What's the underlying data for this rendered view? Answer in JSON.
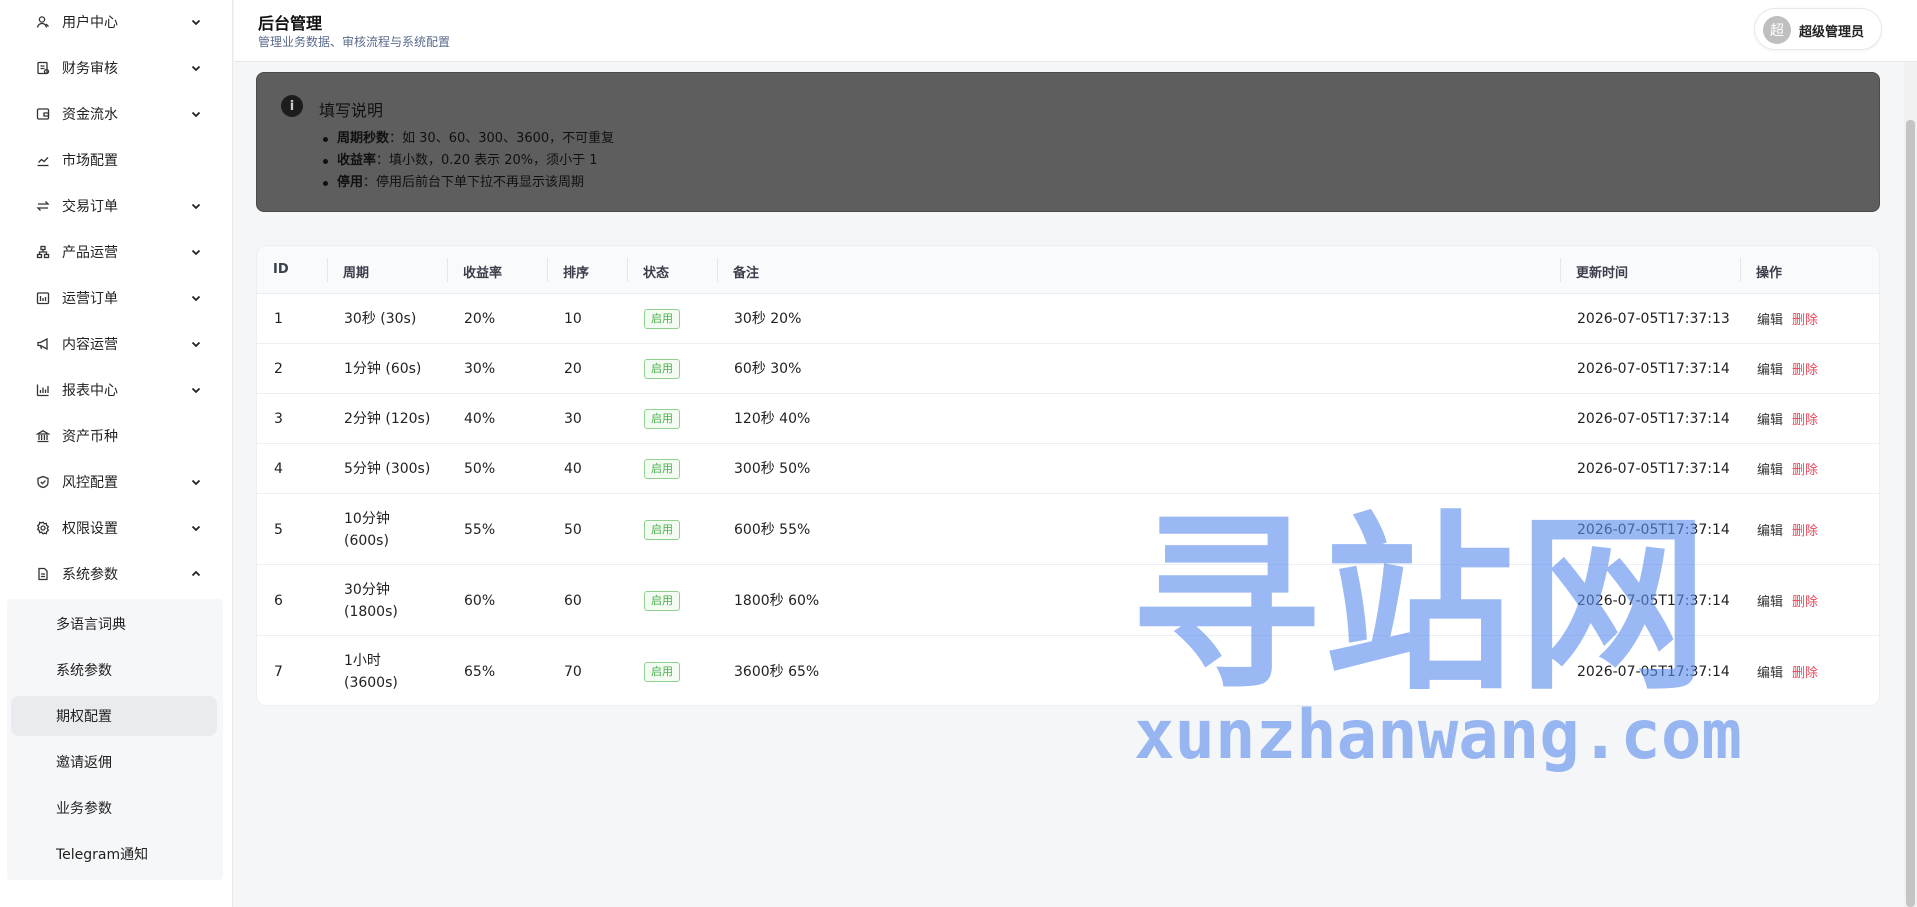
{
  "sidebar": {
    "items": [
      {
        "label": "用户中心",
        "icon": "user-icon",
        "expandable": true
      },
      {
        "label": "财务审核",
        "icon": "receipt-icon",
        "expandable": true
      },
      {
        "label": "资金流水",
        "icon": "wallet-icon",
        "expandable": true
      },
      {
        "label": "市场配置",
        "icon": "chart-line-icon",
        "expandable": false
      },
      {
        "label": "交易订单",
        "icon": "swap-icon",
        "expandable": true
      },
      {
        "label": "产品运营",
        "icon": "hierarchy-icon",
        "expandable": true
      },
      {
        "label": "运营订单",
        "icon": "calendar-icon",
        "expandable": true
      },
      {
        "label": "内容运营",
        "icon": "megaphone-icon",
        "expandable": true
      },
      {
        "label": "报表中心",
        "icon": "bar-chart-icon",
        "expandable": true
      },
      {
        "label": "资产币种",
        "icon": "bank-icon",
        "expandable": false
      },
      {
        "label": "风控配置",
        "icon": "shield-icon",
        "expandable": true
      },
      {
        "label": "权限设置",
        "icon": "gear-icon",
        "expandable": true
      },
      {
        "label": "系统参数",
        "icon": "document-icon",
        "expandable": true,
        "expanded": true
      }
    ],
    "submenu": [
      {
        "label": "多语言词典"
      },
      {
        "label": "系统参数"
      },
      {
        "label": "期权配置",
        "active": true
      },
      {
        "label": "邀请返佣"
      },
      {
        "label": "业务参数"
      },
      {
        "label": "Telegram通知"
      }
    ]
  },
  "header": {
    "title": "后台管理",
    "subtitle": "管理业务数据、审核流程与系统配置",
    "avatar_text": "超",
    "user_name": "超级管理员"
  },
  "notice": {
    "title": "填写说明",
    "items": [
      {
        "bold": "周期秒数",
        "text": "：如 30、60、300、3600，不可重复"
      },
      {
        "bold": "收益率",
        "text": "：填小数，0.20 表示 20%，须小于 1"
      },
      {
        "bold": "停用",
        "text": "：停用后前台下单下拉不再显示该周期"
      }
    ]
  },
  "table": {
    "headers": {
      "id": "ID",
      "period": "周期",
      "rate": "收益率",
      "sort": "排序",
      "status": "状态",
      "remark": "备注",
      "updated": "更新时间",
      "actions": "操作"
    },
    "edit_label": "编辑",
    "delete_label": "删除",
    "rows": [
      {
        "id": "1",
        "period_l1": "30秒 (30s)",
        "period_l2": "",
        "rate": "20%",
        "sort": "10",
        "status": "启用",
        "remark": "30秒 20%",
        "updated": "2026-07-05T17:37:13"
      },
      {
        "id": "2",
        "period_l1": "1分钟 (60s)",
        "period_l2": "",
        "rate": "30%",
        "sort": "20",
        "status": "启用",
        "remark": "60秒 30%",
        "updated": "2026-07-05T17:37:14"
      },
      {
        "id": "3",
        "period_l1": "2分钟 (120s)",
        "period_l2": "",
        "rate": "40%",
        "sort": "30",
        "status": "启用",
        "remark": "120秒 40%",
        "updated": "2026-07-05T17:37:14"
      },
      {
        "id": "4",
        "period_l1": "5分钟 (300s)",
        "period_l2": "",
        "rate": "50%",
        "sort": "40",
        "status": "启用",
        "remark": "300秒 50%",
        "updated": "2026-07-05T17:37:14"
      },
      {
        "id": "5",
        "period_l1": "10分钟",
        "period_l2": "(600s)",
        "rate": "55%",
        "sort": "50",
        "status": "启用",
        "remark": "600秒 55%",
        "updated": "2026-07-05T17:37:14"
      },
      {
        "id": "6",
        "period_l1": "30分钟",
        "period_l2": "(1800s)",
        "rate": "60%",
        "sort": "60",
        "status": "启用",
        "remark": "1800秒 60%",
        "updated": "2026-07-05T17:37:14"
      },
      {
        "id": "7",
        "period_l1": "1小时",
        "period_l2": "(3600s)",
        "rate": "65%",
        "sort": "70",
        "status": "启用",
        "remark": "3600秒 65%",
        "updated": "2026-07-05T17:37:14"
      }
    ]
  },
  "watermark": {
    "cn": "寻站网",
    "en": "xunzhanwang.com"
  },
  "colors": {
    "status_green": "#4caf50",
    "delete_red": "#e8475b",
    "watermark_blue": "#5c8cee",
    "notice_bg": "#5e5e5e"
  }
}
